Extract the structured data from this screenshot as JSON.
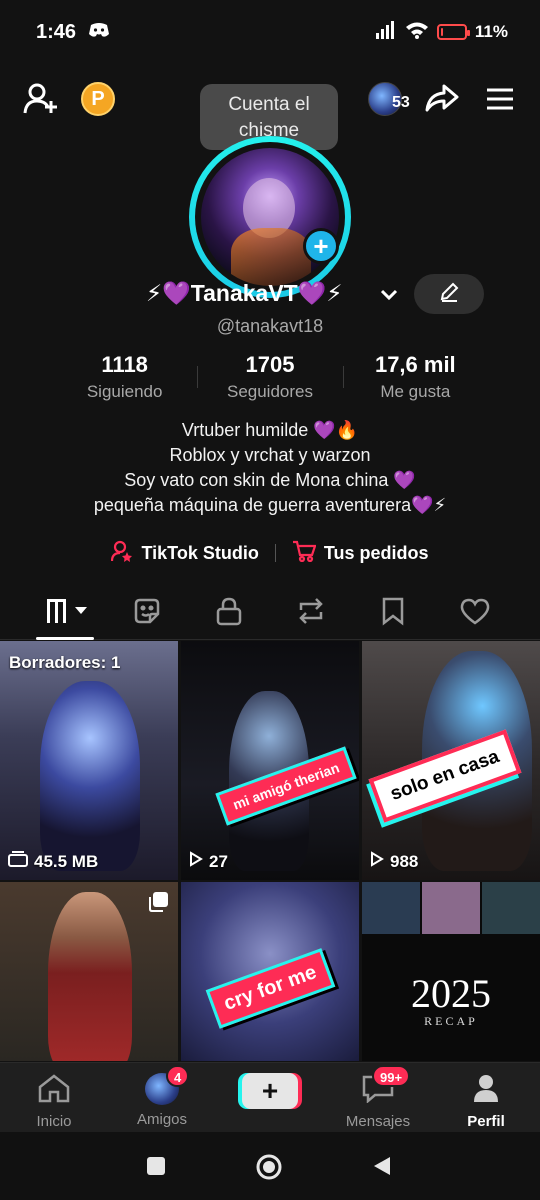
{
  "status_bar": {
    "time": "1:46",
    "battery_text": "11%",
    "battery_level": 0.11
  },
  "top_bar": {
    "coin_letter": "P",
    "tooltip": "Cuenta el chisme",
    "follower_avatar_count": "53"
  },
  "profile": {
    "display_name": "⚡💜TanakaVT💜⚡",
    "username": "@tanakavt18",
    "stats": [
      {
        "value": "1118",
        "label": "Siguiendo"
      },
      {
        "value": "1705",
        "label": "Seguidores"
      },
      {
        "value": "17,6 mil",
        "label": "Me gusta"
      }
    ],
    "bio_lines": [
      "Vrtuber humilde 💜🔥",
      "Roblox y vrchat y warzon",
      "Soy vato con skin de Mona china 💜",
      "pequeña máquina de guerra aventurera💜⚡"
    ],
    "links": [
      {
        "label": "TikTok Studio"
      },
      {
        "label": "Tus pedidos"
      }
    ]
  },
  "tabs": [
    {
      "icon": "grid-icon",
      "active": true
    },
    {
      "icon": "sticker-icon",
      "active": false
    },
    {
      "icon": "lock-icon",
      "active": false
    },
    {
      "icon": "repost-icon",
      "active": false
    },
    {
      "icon": "bookmark-icon",
      "active": false
    },
    {
      "icon": "heart-icon",
      "active": false
    }
  ],
  "videos": [
    {
      "overlay": "Borradores: 1",
      "stat": "45.5 MB",
      "stat_icon": "drafts-icon"
    },
    {
      "sticker": "mi amigó therian",
      "stat": "27",
      "stat_icon": "play-icon"
    },
    {
      "sticker": "solo en casa",
      "stat": "988",
      "stat_icon": "play-icon"
    },
    {
      "stat_icon": "multi-photo-icon"
    },
    {
      "sticker": "cry for me"
    },
    {
      "recap_year": "2025",
      "recap_word": "RECAP"
    }
  ],
  "bottom_nav": [
    {
      "label": "Inicio",
      "icon": "home-icon"
    },
    {
      "label": "Amigos",
      "icon": "friends-avatar",
      "badge": "4"
    },
    {
      "label": "",
      "icon": "create-icon"
    },
    {
      "label": "Mensajes",
      "icon": "inbox-icon",
      "badge": "99+"
    },
    {
      "label": "Perfil",
      "icon": "profile-icon",
      "active": true
    }
  ],
  "colors": {
    "accent_cyan": "#25f4ee",
    "accent_red": "#fe2c55",
    "background": "#121212",
    "coin": "#f5a623"
  }
}
